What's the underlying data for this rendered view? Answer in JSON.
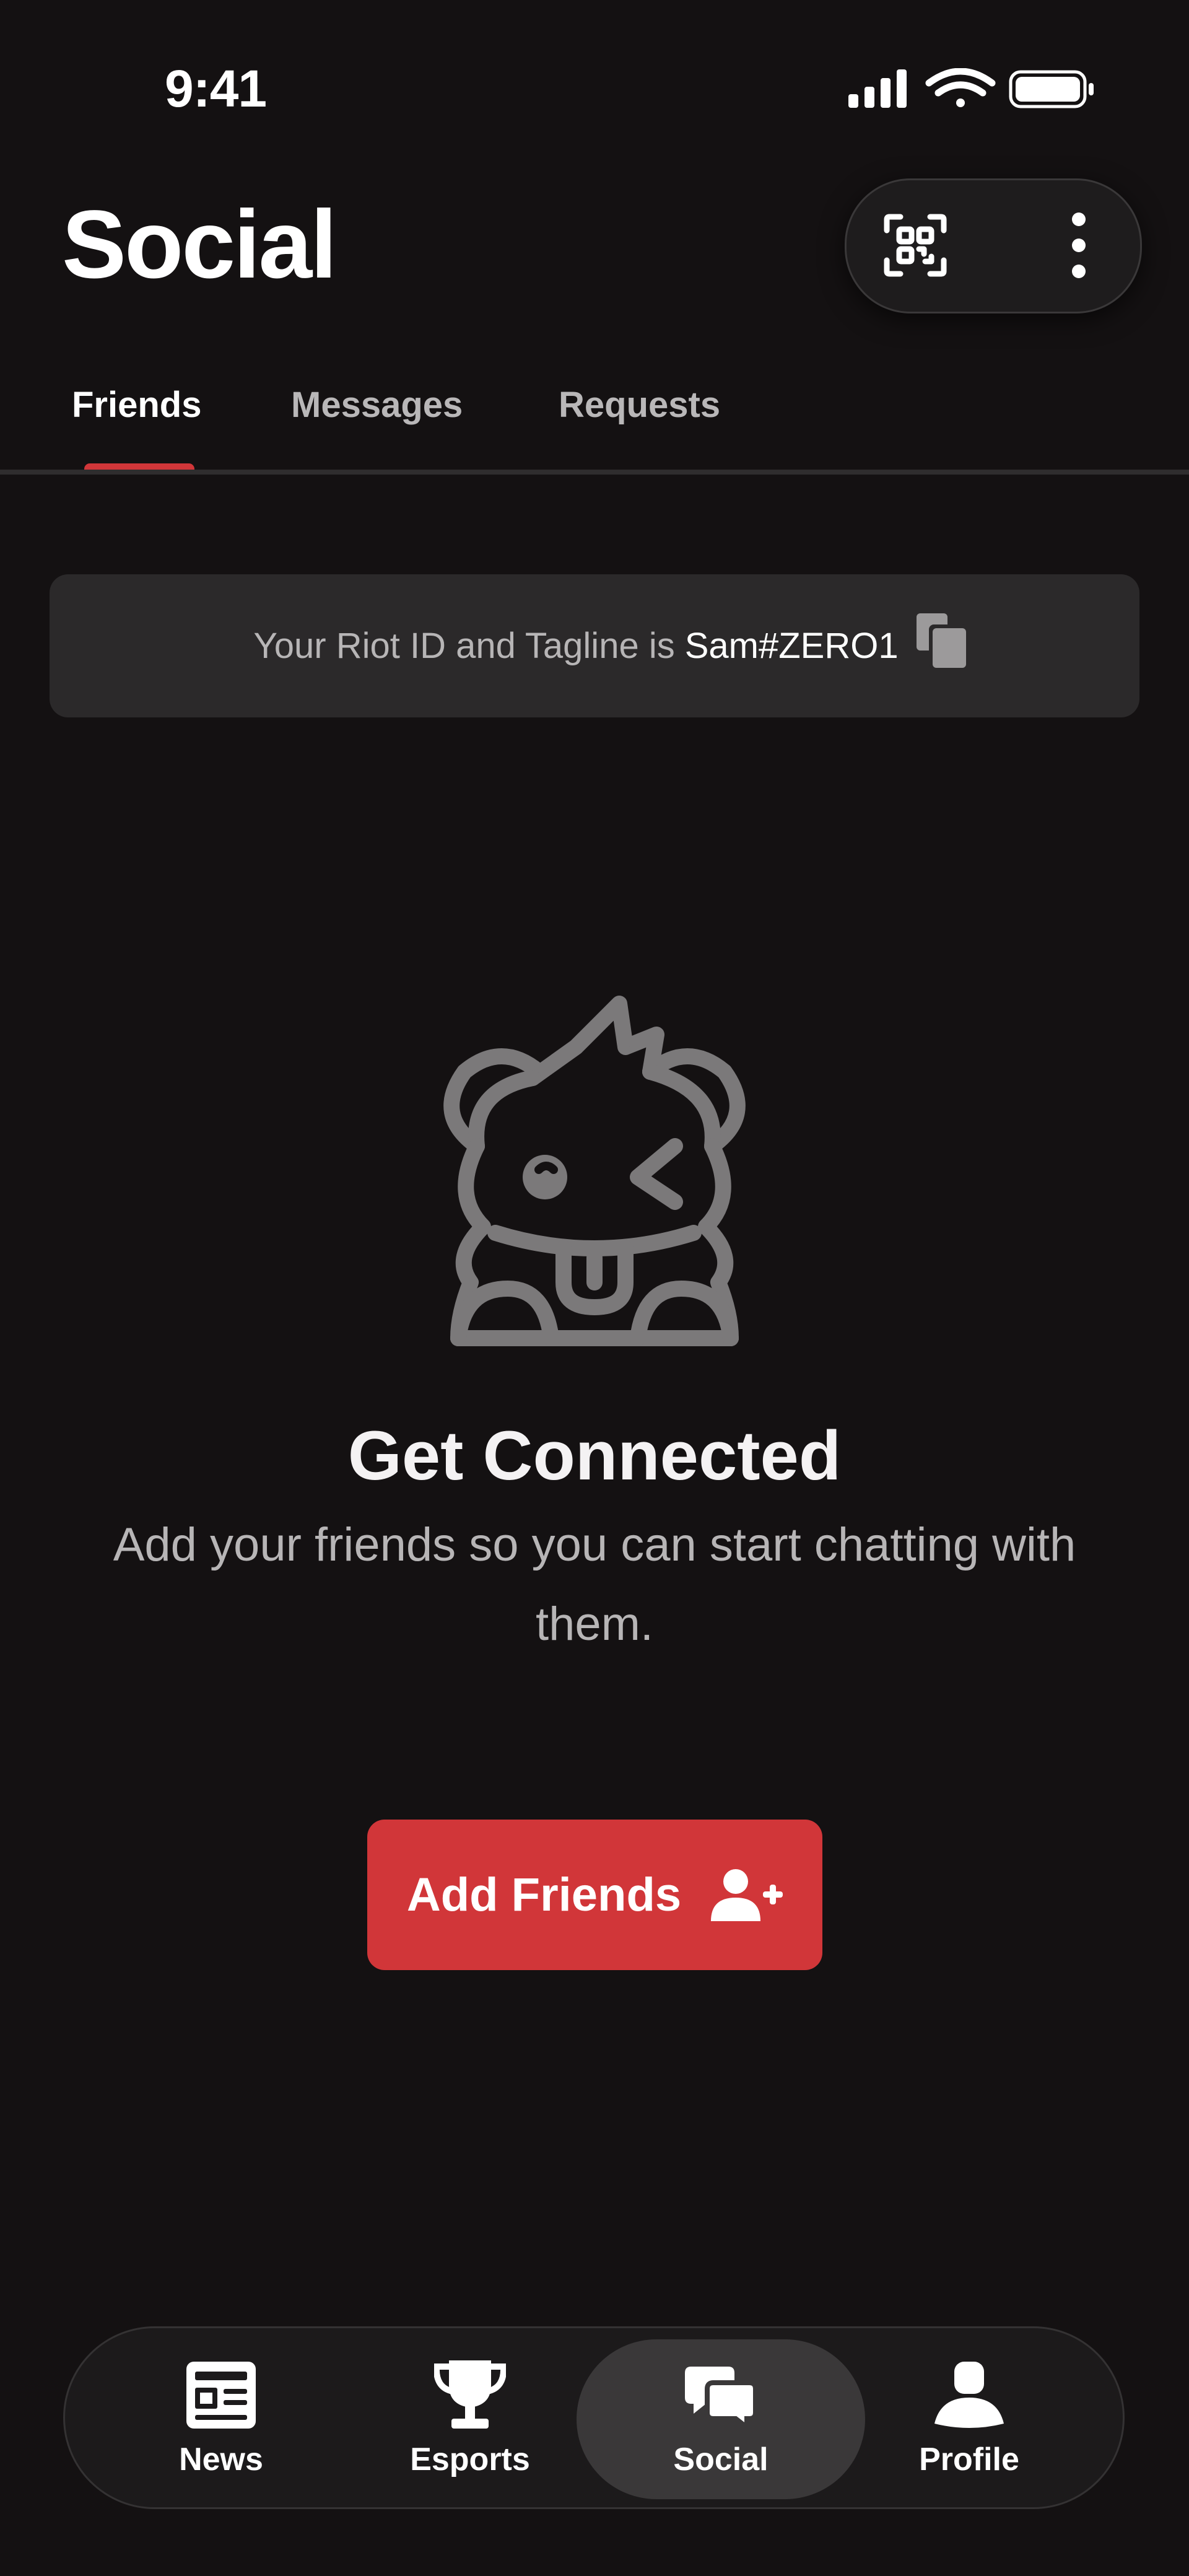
{
  "status_bar": {
    "time": "9:41",
    "icons": [
      "signal-icon",
      "wifi-icon",
      "battery-icon"
    ]
  },
  "header": {
    "title": "Social",
    "actions": [
      "qr-code-icon",
      "more-vertical-icon"
    ]
  },
  "tabs": [
    {
      "label": "Friends",
      "active": true
    },
    {
      "label": "Messages",
      "active": false
    },
    {
      "label": "Requests",
      "active": false
    }
  ],
  "riot_id": {
    "prefix": "Your Riot ID and Tagline is",
    "value": "Sam#ZERO1",
    "icon": "copy-icon"
  },
  "empty_state": {
    "icon": "poro-mascot-icon",
    "title": "Get Connected",
    "body": "Add your friends so you can start chatting with them."
  },
  "primary_action": {
    "label": "Add Friends",
    "icon": "add-user-icon"
  },
  "bottom_nav": [
    {
      "label": "News",
      "icon": "newspaper-icon",
      "active": false
    },
    {
      "label": "Esports",
      "icon": "trophy-icon",
      "active": false
    },
    {
      "label": "Social",
      "icon": "chat-bubbles-icon",
      "active": true
    },
    {
      "label": "Profile",
      "icon": "profile-icon",
      "active": false
    }
  ],
  "colors": {
    "background": "#141112",
    "accent": "#d13639",
    "surface": "#2b292a",
    "muted_text": "#b7b5b6"
  }
}
